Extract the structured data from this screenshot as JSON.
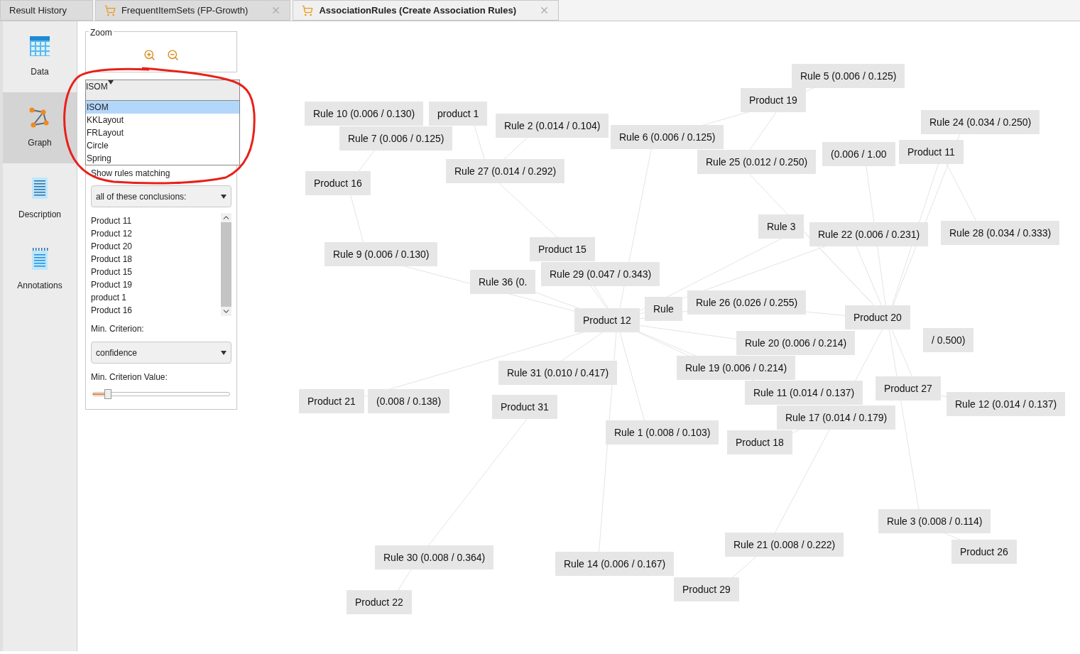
{
  "tabs": [
    {
      "label": "Result History",
      "selected": false,
      "has_icon": false,
      "closable": false
    },
    {
      "label": "FrequentItemSets (FP-Growth)",
      "selected": false,
      "has_icon": true,
      "closable": true
    },
    {
      "label": "AssociationRules (Create Association Rules)",
      "selected": true,
      "has_icon": true,
      "closable": true
    }
  ],
  "views": [
    {
      "label": "Data",
      "kind": "data",
      "selected": false
    },
    {
      "label": "Graph",
      "kind": "graph",
      "selected": true
    },
    {
      "label": "Description",
      "kind": "description",
      "selected": false
    },
    {
      "label": "Annotations",
      "kind": "annotations",
      "selected": false
    }
  ],
  "zoom": {
    "title": "Zoom"
  },
  "layout_select": {
    "value": "ISOM",
    "expanded": true,
    "options": [
      {
        "label": "ISOM",
        "selected": true
      },
      {
        "label": "KKLayout",
        "selected": false
      },
      {
        "label": "FRLayout",
        "selected": false
      },
      {
        "label": "Circle",
        "selected": false
      },
      {
        "label": "Spring",
        "selected": false
      }
    ]
  },
  "filter": {
    "label": "Show rules matching",
    "mode": "all of these conclusions:",
    "items": [
      "Product 11",
      "Product 12",
      "Product 20",
      "Product 18",
      "Product 15",
      "Product 19",
      "product 1",
      "Product 16"
    ]
  },
  "criterion": {
    "label": "Min. Criterion:",
    "value": "confidence"
  },
  "criterion_value": {
    "label": "Min. Criterion Value:",
    "level": 0.11
  },
  "graph": {
    "nodes": [
      "Rule 10 (0.006 / 0.130)",
      "product 1",
      "Rule 7 (0.006 / 0.125)",
      "Rule 2 (0.014 / 0.104)",
      "Rule 27 (0.014 / 0.292)",
      "Product 16",
      "Rule 9 (0.006 / 0.130)",
      "Product 15",
      "Rule 29 (0.047 / 0.343)",
      "Rule 36 (0.",
      "Product 12",
      "Rule",
      "Rule 26 (0.026 / 0.255)",
      "Rule 6 (0.006 / 0.125)",
      "Product 19",
      "Rule 5 (0.006 / 0.125)",
      "Rule 25 (0.012 / 0.250)",
      "(0.006 / 1.00",
      "Rule 24 (0.034 / 0.250)",
      "Product 11",
      "Rule 3",
      "Rule 22 (0.006 / 0.231)",
      "Rule 28 (0.034 / 0.333)",
      "Product 20",
      "/ 0.500)",
      "Rule 20 (0.006 / 0.214)",
      "Rule 19 (0.006 / 0.214)",
      "Rule 11 (0.014 / 0.137)",
      "Product 27",
      "Rule 12 (0.014 / 0.137)",
      "Rule 17 (0.014 / 0.179)",
      "Product 18",
      "Rule 1 (0.008 / 0.103)",
      "Rule 31 (0.010 / 0.417)",
      "Product 31",
      "Product 21",
      "(0.008 / 0.138)",
      "Rule 30 (0.008 / 0.364)",
      "Product 22",
      "Rule 14 (0.006 / 0.167)",
      "Product 29",
      "Rule 21 (0.008 / 0.222)",
      "Rule 3 (0.008 / 0.114)",
      "Product 26"
    ]
  }
}
